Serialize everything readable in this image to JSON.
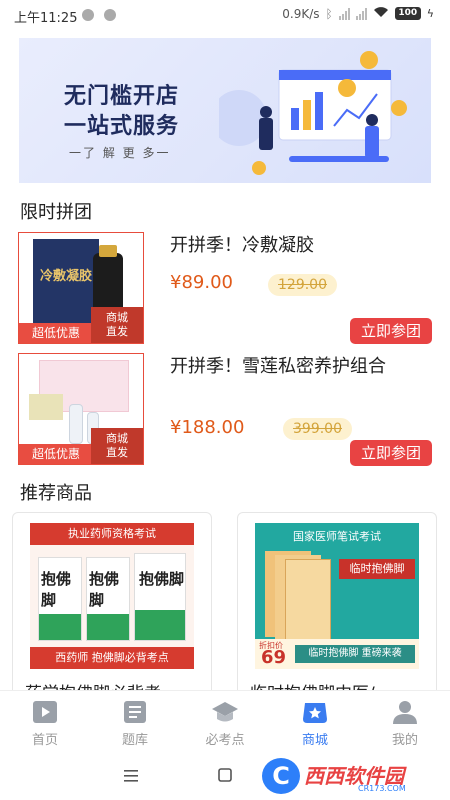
{
  "status_bar": {
    "time": "上午11:25",
    "speed": "0.9K/s",
    "battery": "100"
  },
  "banner": {
    "line1": "无门槛开店",
    "line2": "一站式服务",
    "more": "一了 解 更 多一"
  },
  "group_section": {
    "title": "限时拼团",
    "items": [
      {
        "name": "开拼季！冷敷凝胶",
        "price": "¥89.00",
        "original_price": "129.00",
        "button": "立即参团",
        "badge_left": "超低优惠",
        "badge_right_1": "商城",
        "badge_right_2": "直发",
        "box_text": "冷敷凝胶"
      },
      {
        "name": "开拼季！雪莲私密养护组合",
        "price": "¥188.00",
        "original_price": "399.00",
        "button": "立即参团",
        "badge_left": "超低优惠",
        "badge_right_1": "商城",
        "badge_right_2": "直发"
      }
    ]
  },
  "recommend_section": {
    "title": "推荐商品",
    "cards": [
      {
        "title": "药学抱佛脚必背考",
        "img_header": "执业药师资格考试",
        "img_footer": "西药师 抱佛脚必背考点",
        "book_text": "抱佛脚"
      },
      {
        "title": "临时抱佛脚中医/",
        "img_header": "国家医师笔试考试",
        "img_tag": "临时抱佛脚",
        "price_label": "折扣价",
        "price": "69",
        "img_footer": "临时抱佛脚 重磅来袭"
      }
    ]
  },
  "tab_bar": {
    "tabs": [
      {
        "label": "首页",
        "icon": "play-icon"
      },
      {
        "label": "题库",
        "icon": "question-bank-icon"
      },
      {
        "label": "必考点",
        "icon": "graduation-cap-icon"
      },
      {
        "label": "商城",
        "icon": "star-shop-icon",
        "active": true
      },
      {
        "label": "我的",
        "icon": "person-icon"
      }
    ]
  },
  "watermark": {
    "text": "西西软件园",
    "url": "CR173.COM"
  },
  "colors": {
    "accent": "#3a7cf0",
    "price": "#e05a1a",
    "button": "#e84343"
  }
}
